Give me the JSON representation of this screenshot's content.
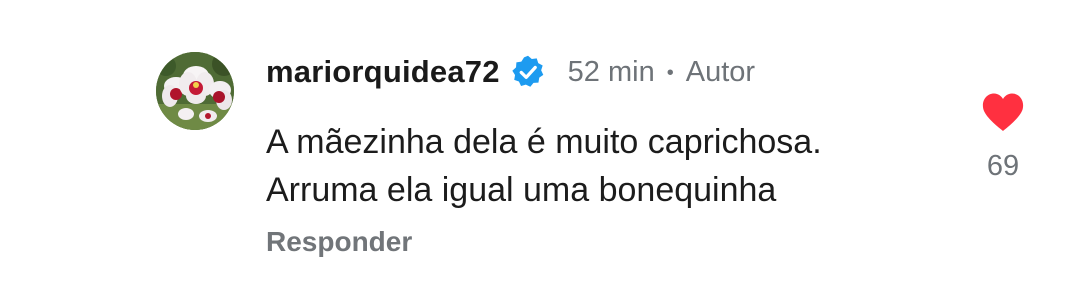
{
  "comment": {
    "author": {
      "username": "mariorquidea72",
      "avatar_icon": "orchid-avatar",
      "verified_icon": "verified-badge-icon",
      "verified_color": "#1d9bf0"
    },
    "time": "52 min",
    "separator": "•",
    "author_badge": "Autor",
    "text_lines": [
      "A mãezinha dela é muito caprichosa.",
      "Arruma ela igual uma bonequinha"
    ],
    "reply_label": "Responder",
    "like": {
      "icon": "heart-icon",
      "liked": true,
      "color": "#ff3040",
      "count": "69"
    }
  }
}
